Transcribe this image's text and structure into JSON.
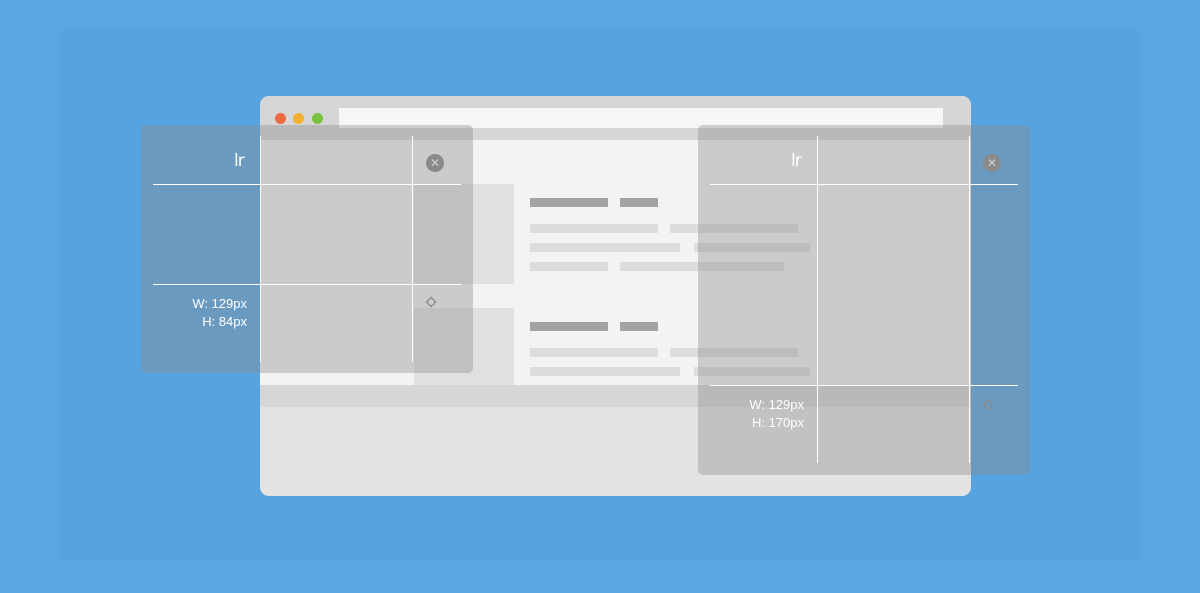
{
  "colors": {
    "background": "#59a6e0",
    "window_chrome": "#d6d6d6",
    "traffic_red": "#ee6a43",
    "traffic_yellow": "#f1b12f",
    "traffic_green": "#78c23e"
  },
  "overlays": [
    {
      "logo": "lr",
      "width_text": "W: 129px",
      "height_text": "H: 84px",
      "close_icon": "close-icon",
      "settings_icon": "gear-icon"
    },
    {
      "logo": "lr",
      "width_text": "W: 129px",
      "height_text": "H: 170px",
      "close_icon": "close-icon",
      "settings_icon": "gear-icon"
    }
  ]
}
